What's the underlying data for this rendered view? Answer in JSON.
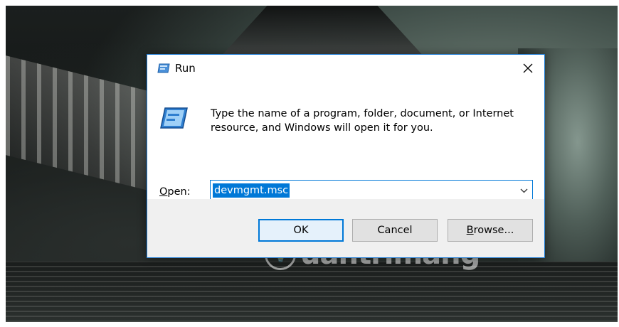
{
  "window": {
    "title": "Run",
    "close_glyph": "✕",
    "title_icon": "run-icon"
  },
  "content": {
    "description": "Type the name of a program, folder, document, or Internet resource, and Windows will open it for you.",
    "open_label_accel": "O",
    "open_label_rest": "pen:",
    "open_value": "devmgmt.msc"
  },
  "buttons": {
    "ok_label": "OK",
    "cancel_label": "Cancel",
    "browse_label_accel": "B",
    "browse_label_rest": "rowse..."
  },
  "watermark": {
    "text": "uantrimang"
  },
  "colors": {
    "accent": "#0078d7",
    "footer": "#f0f0f0",
    "border": "#1c7bd6"
  }
}
